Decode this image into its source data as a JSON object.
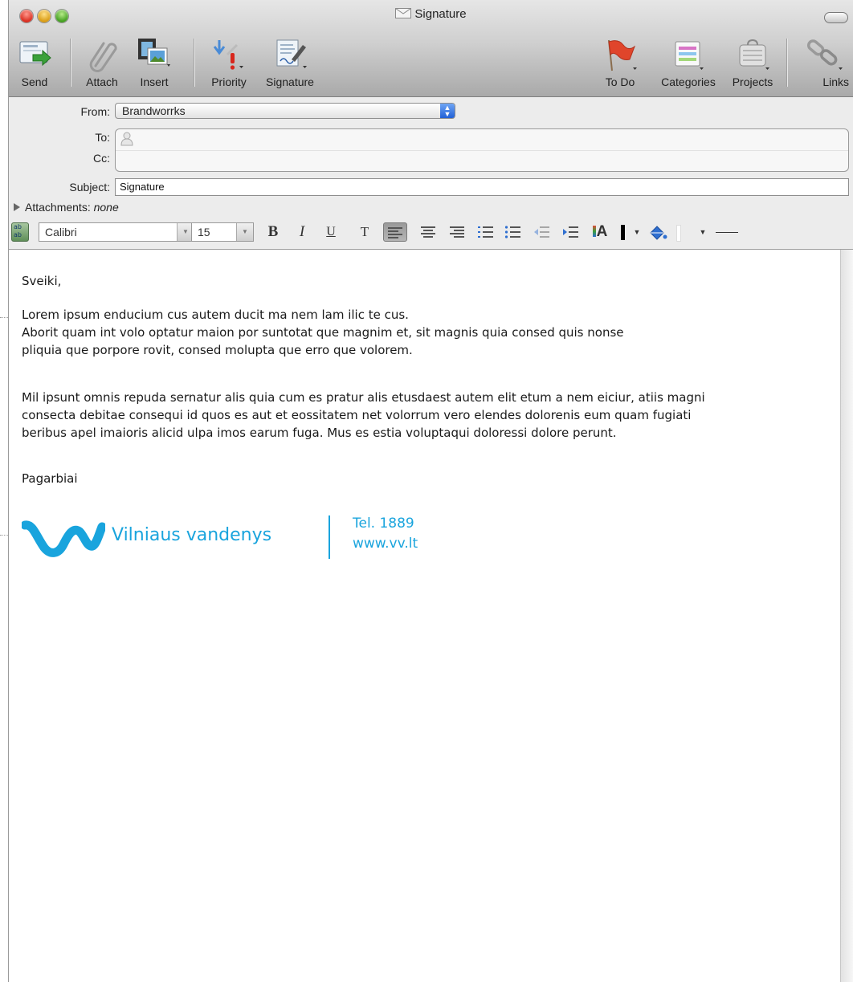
{
  "window": {
    "title": "Signature"
  },
  "toolbar": {
    "send": "Send",
    "attach": "Attach",
    "insert": "Insert",
    "priority": "Priority",
    "signature": "Signature",
    "todo": "To Do",
    "categories": "Categories",
    "projects": "Projects",
    "links": "Links"
  },
  "header": {
    "from_label": "From:",
    "from_value": "Brandworrks",
    "to_label": "To:",
    "cc_label": "Cc:",
    "subject_label": "Subject:",
    "subject_value": "Signature",
    "attachments_label": "Attachments:",
    "attachments_value": "none"
  },
  "format": {
    "font": "Calibri",
    "size": "15",
    "bold": "B",
    "italic": "I",
    "underline": "U",
    "text": "T",
    "font_color_glyph": "A"
  },
  "message": {
    "greeting": "Sveiki,",
    "p1": [
      "Lorem ipsum enducium cus autem ducit ma nem lam ilic te cus.",
      "Aborit quam int volo optatur maion por suntotat que magnim et, sit magnis quia consed quis nonse",
      "pliquia que porpore rovit, consed molupta que erro que volorem."
    ],
    "p2": [
      "Mil ipsunt omnis repuda sernatur alis quia cum es pratur alis etusdaest autem elit etum a nem eiciur, atiis magni",
      "consecta debitae consequi id quos es aut et eossitatem net volorrum vero elendes dolorenis eum quam fugiati",
      "beribus apel imaioris alicid ulpa imos earum fuga. Mus es estia voluptaqui doloressi dolore perunt."
    ],
    "closing": "Pagarbiai"
  },
  "signature": {
    "brand": "Vilniaus vandenys",
    "phone": "Tel. 1889",
    "web": "www.vv.lt",
    "brand_color": "#19a4dd"
  },
  "icons": [
    "send-icon",
    "paperclip-icon",
    "insert-media-icon",
    "priority-icon",
    "signature-icon",
    "flag-icon",
    "categories-icon",
    "projects-icon",
    "links-icon",
    "spellcheck-icon",
    "contact-icon"
  ]
}
